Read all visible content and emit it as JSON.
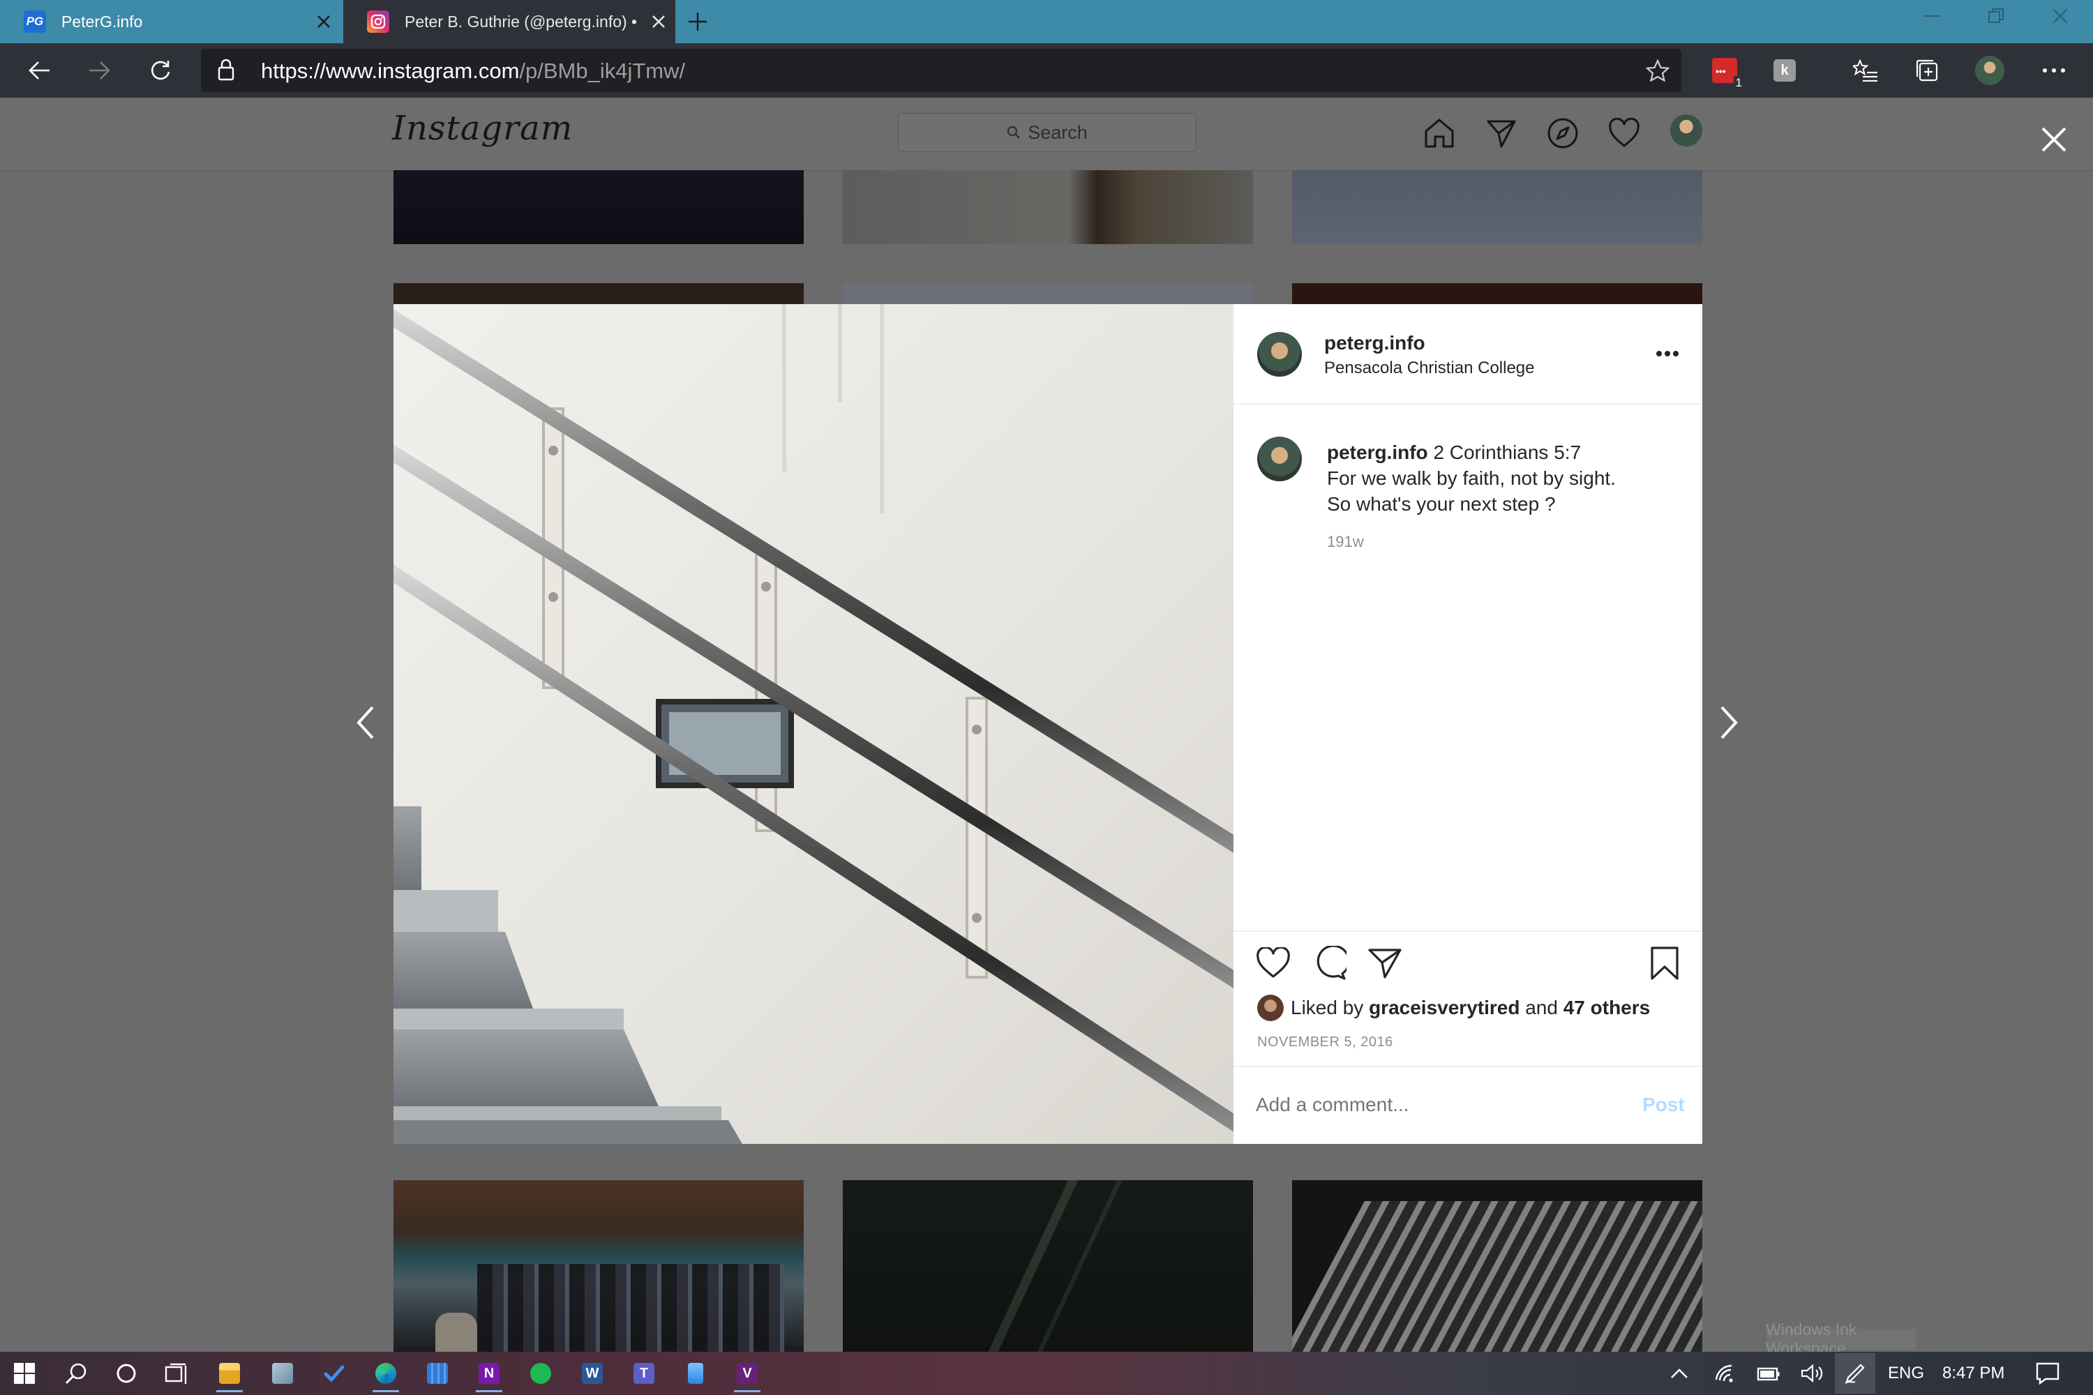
{
  "browser": {
    "tabs": [
      {
        "title": "PeterG.info",
        "active": false
      },
      {
        "title": "Peter B. Guthrie (@peterg.info) •",
        "active": true
      }
    ],
    "url": {
      "host": "https://www.instagram.com",
      "path": "/p/BMb_ik4jTmw/"
    },
    "extension_badge": "1"
  },
  "instagram": {
    "logo": "Instagram",
    "search_placeholder": "Search",
    "nav_icons": [
      "home-icon",
      "direct-icon",
      "explore-icon",
      "activity-heart-icon",
      "profile-avatar"
    ]
  },
  "post": {
    "username": "peterg.info",
    "location": "Pensacola Christian College",
    "caption": {
      "username": "peterg.info",
      "line1": "2 Corinthians 5:7",
      "line2": "For we walk by faith, not by sight.",
      "line3": "So what's your next step ?",
      "age": "191w"
    },
    "likes": {
      "prefix": "Liked by",
      "user": "graceisverytired",
      "joiner": "and",
      "others": "47 others"
    },
    "date": "NOVEMBER 5, 2016",
    "comment_placeholder": "Add a comment...",
    "post_button": "Post"
  },
  "taskbar": {
    "language": "ENG",
    "time": "8:47 PM",
    "ink_workspace_tooltip": "Windows Ink Workspace"
  },
  "colors": {
    "tab_strip": "#3d8aa9",
    "toolbar": "#2f3138",
    "overlay": "#6b6b6b",
    "post_button": "#b3dbff",
    "text": "#262626",
    "muted": "#8e8e8e"
  }
}
